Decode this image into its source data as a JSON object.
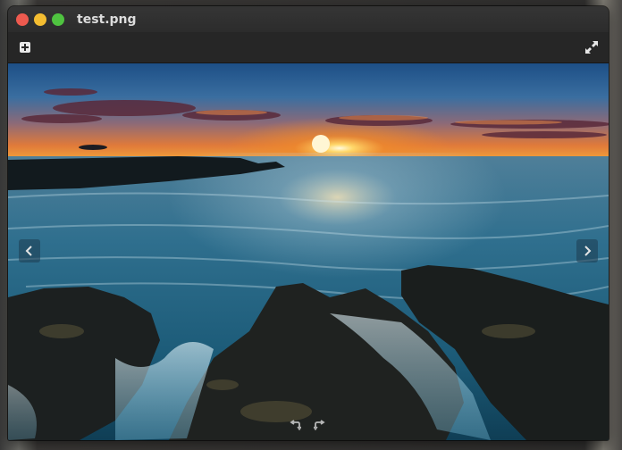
{
  "window": {
    "title": "test.png"
  },
  "toolbar": {
    "add_icon": "add-icon",
    "fullscreen_icon": "fullscreen-icon"
  },
  "viewer": {
    "image_description_icon": "image",
    "prev_icon": "chevron-left-icon",
    "next_icon": "chevron-right-icon",
    "rotate_left_icon": "rotate-left-icon",
    "rotate_right_icon": "rotate-right-icon"
  },
  "colors": {
    "close": "#ed5a4f",
    "minimize": "#f4bd31",
    "maximize": "#4fc340",
    "titlebar": "#2c2c2c",
    "title_text": "#dcdcdc"
  }
}
